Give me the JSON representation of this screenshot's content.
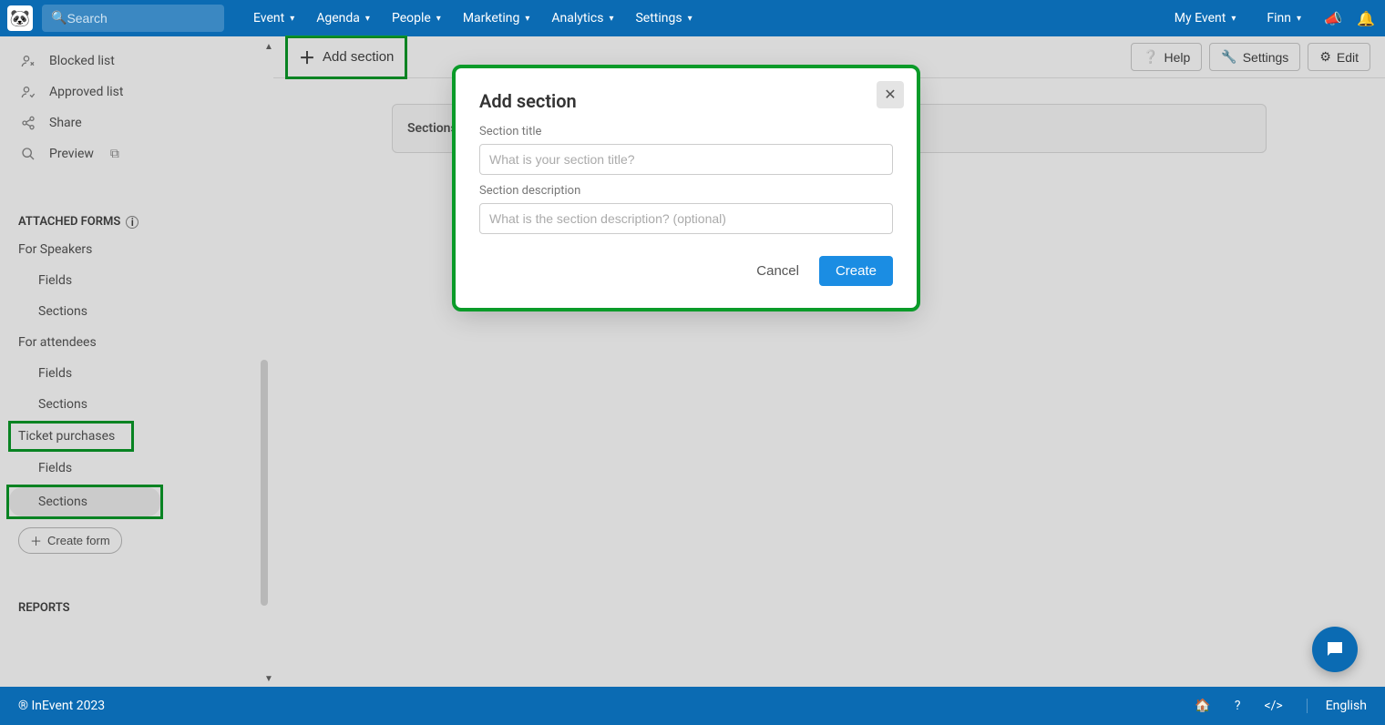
{
  "topnav": {
    "search_placeholder": "Search",
    "menu": [
      "Event",
      "Agenda",
      "People",
      "Marketing",
      "Analytics",
      "Settings"
    ],
    "right_menu": [
      "My Event",
      "Finn"
    ]
  },
  "sidebar": {
    "items": [
      {
        "icon": "person-x",
        "label": "Blocked list"
      },
      {
        "icon": "person-check",
        "label": "Approved list"
      },
      {
        "icon": "share",
        "label": "Share"
      },
      {
        "icon": "search",
        "label": "Preview",
        "ext": true
      }
    ],
    "section_header": "ATTACHED FORMS",
    "groups": [
      {
        "title": "For Speakers",
        "items": [
          "Fields",
          "Sections"
        ]
      },
      {
        "title": "For attendees",
        "items": [
          "Fields",
          "Sections"
        ]
      },
      {
        "title": "Ticket purchases",
        "items": [
          "Fields",
          "Sections"
        ],
        "highlight_title": true,
        "highlight_item_index": 1,
        "selected_item_index": 1
      }
    ],
    "create_form": "Create form",
    "reports_header": "REPORTS"
  },
  "toolbar": {
    "add_section": "Add section",
    "right": [
      {
        "icon": "help",
        "label": "Help"
      },
      {
        "icon": "wrench",
        "label": "Settings"
      },
      {
        "icon": "gear",
        "label": "Edit"
      }
    ]
  },
  "sections_row": "Sections",
  "modal": {
    "title": "Add section",
    "field1_label": "Section title",
    "field1_placeholder": "What is your section title?",
    "field2_label": "Section description",
    "field2_placeholder": "What is the section description? (optional)",
    "cancel": "Cancel",
    "create": "Create"
  },
  "footer": {
    "copyright": "® InEvent 2023",
    "language": "English"
  }
}
